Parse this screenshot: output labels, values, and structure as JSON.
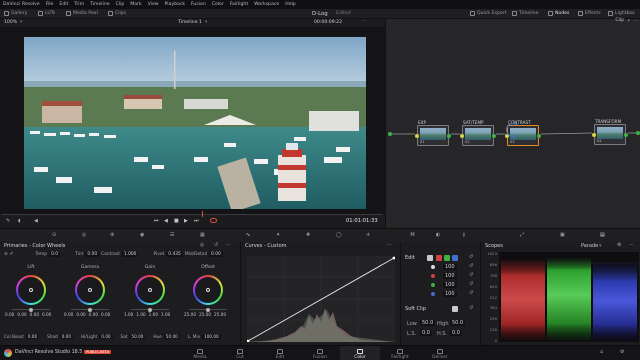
{
  "menubar": {
    "items": [
      "DaVinci Resolve",
      "File",
      "Edit",
      "Trim",
      "Timeline",
      "Clip",
      "Mark",
      "View",
      "Playback",
      "Fusion",
      "Color",
      "Fairlight",
      "Workspace",
      "Help"
    ]
  },
  "toolbar": {
    "left": [
      "Gallery",
      "LUTs",
      "Media Pool",
      "Clips"
    ],
    "project_title": "D-Log",
    "project_status": "Edited",
    "right": [
      "Quick Export",
      "Timeline",
      "Nodes",
      "Effects",
      "Lightbox"
    ]
  },
  "viewer": {
    "zoom": "100%",
    "timeline_name": "Timeline 1",
    "timecode_top": "00:00:09:22",
    "timecode": "01:01:01:33"
  },
  "nodegraph": {
    "mode": "Clip",
    "nodes": [
      {
        "label": "EXP",
        "num": "01"
      },
      {
        "label": "SAT/TEMP",
        "num": "02"
      },
      {
        "label": "CONTRAST",
        "num": "03"
      },
      {
        "label": "TRANSFORM",
        "num": "04"
      }
    ]
  },
  "primaries": {
    "title": "Primaries - Color Wheels",
    "params_top": [
      {
        "label": "Temp",
        "value": "0.0"
      },
      {
        "label": "Tint",
        "value": "0.00"
      },
      {
        "label": "Contrast",
        "value": "1.000"
      },
      {
        "label": "Pivot",
        "value": "0.435"
      },
      {
        "label": "Mid/Detail",
        "value": "0.00"
      }
    ],
    "wheels": [
      {
        "name": "Lift",
        "values": [
          "0.00",
          "0.00",
          "0.00",
          "0.00"
        ]
      },
      {
        "name": "Gamma",
        "values": [
          "0.00",
          "0.00",
          "0.00",
          "0.00"
        ]
      },
      {
        "name": "Gain",
        "values": [
          "1.00",
          "1.00",
          "1.00",
          "1.00"
        ]
      },
      {
        "name": "Offset",
        "values": [
          "25.00",
          "25.00",
          "25.00"
        ]
      }
    ],
    "params_bottom": [
      {
        "label": "Col Boost",
        "value": "0.00"
      },
      {
        "label": "Shad",
        "value": "0.00"
      },
      {
        "label": "Hi/Light",
        "value": "0.00"
      },
      {
        "label": "Sat",
        "value": "50.00"
      },
      {
        "label": "Hue",
        "value": "50.00"
      },
      {
        "label": "L. Mix",
        "value": "100.00"
      }
    ]
  },
  "curves": {
    "title": "Curves - Custom"
  },
  "edit": {
    "title": "Edit",
    "values": [
      "100",
      "100",
      "100",
      "100"
    ],
    "softclip": "Soft Clip",
    "low_label": "Low",
    "low": "50.0",
    "high_label": "High",
    "high": "50.0",
    "ls_label": "L.S.",
    "ls": "0.0",
    "hs_label": "H.S.",
    "hs": "0.0"
  },
  "scopes": {
    "title": "Scopes",
    "mode": "Parade",
    "axis": [
      "1023",
      "896",
      "768",
      "640",
      "512",
      "384",
      "256",
      "128",
      "0"
    ]
  },
  "status": {
    "app": "DaVinci Resolve Studio 18.5",
    "badge": "PUBLIC BETA",
    "pages": [
      "Media",
      "Cut",
      "Edit",
      "Fusion",
      "Color",
      "Fairlight",
      "Deliver"
    ],
    "active_page": "Color"
  },
  "colors": {
    "accent": "#e04a3a",
    "orange": "#e08a20",
    "node_green": "#3bb34a"
  }
}
